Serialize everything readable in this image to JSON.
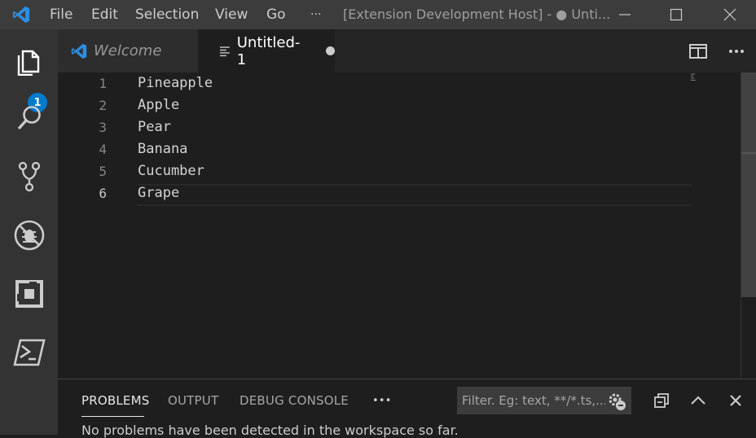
{
  "titlebar": {
    "menu": [
      "File",
      "Edit",
      "Selection",
      "View",
      "Go",
      "···"
    ],
    "window_title": "[Extension Development Host] - ● Unti..."
  },
  "activity": {
    "explorer_badge": "1",
    "items": [
      "explorer-icon",
      "search-icon",
      "source-control-icon",
      "debug-icon",
      "extensions-icon",
      "powershell-icon"
    ]
  },
  "tabs": {
    "welcome": "Welcome",
    "untitled": "Untitled-1"
  },
  "editor": {
    "active_line": 6,
    "lines": [
      {
        "num": "1",
        "text": "Pineapple"
      },
      {
        "num": "2",
        "text": "Apple"
      },
      {
        "num": "3",
        "text": "Pear"
      },
      {
        "num": "4",
        "text": "Banana"
      },
      {
        "num": "5",
        "text": "Cucumber"
      },
      {
        "num": "6",
        "text": "Grape"
      }
    ]
  },
  "panel": {
    "tabs": [
      "PROBLEMS",
      "OUTPUT",
      "DEBUG CONSOLE"
    ],
    "more": "•••",
    "filter_placeholder": "Filter. Eg: text, **/*.ts,...",
    "message": "No problems have been detected in the workspace so far."
  },
  "colors": {
    "accent": "#007acc",
    "titlebar": "#3c3c3c",
    "activitybar": "#333333",
    "editor_bg": "#1e1e1e"
  }
}
